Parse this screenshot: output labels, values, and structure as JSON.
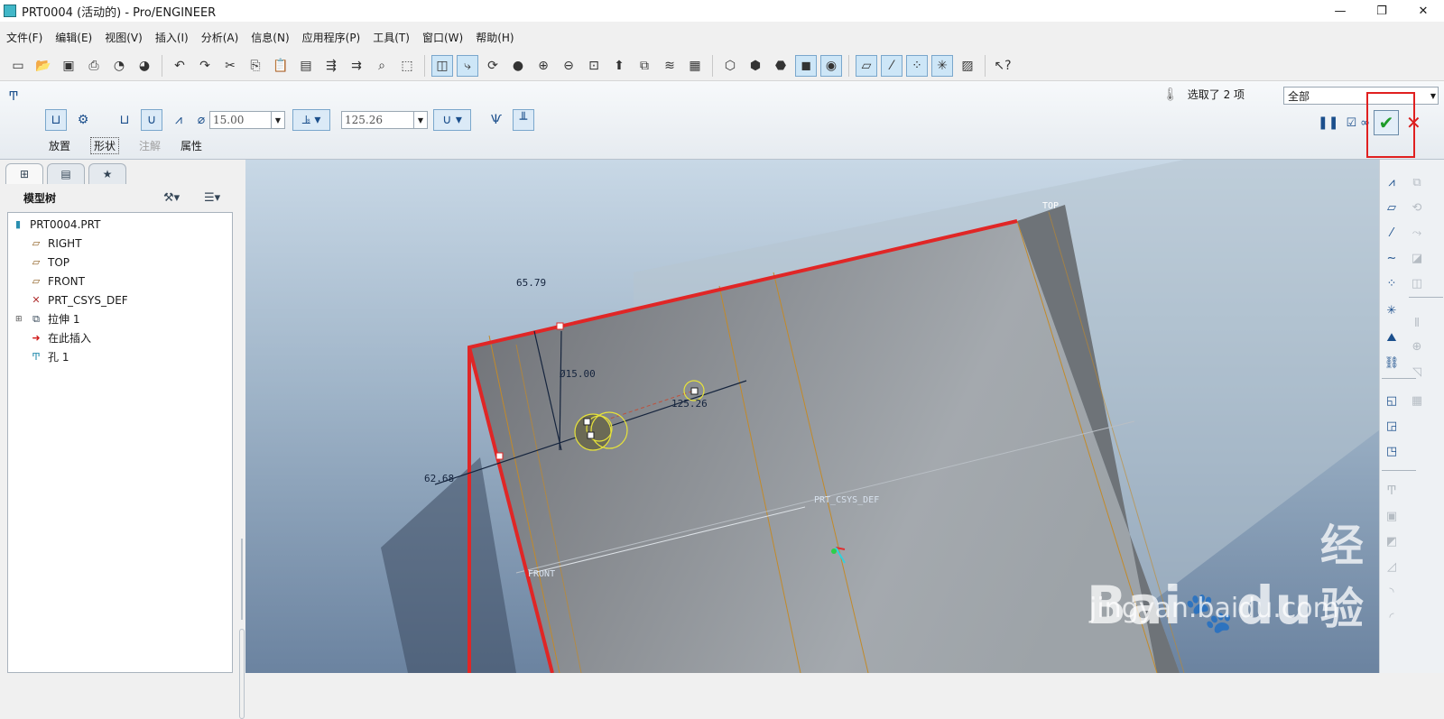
{
  "window": {
    "title": "PRT0004 (活动的) - Pro/ENGINEER",
    "controls": [
      "—",
      "❐",
      "✕"
    ]
  },
  "menu": [
    "文件(F)",
    "编辑(E)",
    "视图(V)",
    "插入(I)",
    "分析(A)",
    "信息(N)",
    "应用程序(P)",
    "工具(T)",
    "窗口(W)",
    "帮助(H)"
  ],
  "dashboard": {
    "diameter_value": "15.00",
    "depth_value": "125.26",
    "tabs": {
      "placement": "放置",
      "shape": "形状",
      "note": "注解",
      "properties": "属性"
    },
    "selection_info": "选取了 2 项",
    "filter_value": "全部"
  },
  "model_tree": {
    "header": "模型树",
    "items": [
      {
        "label": "PRT0004.PRT",
        "icon": "part-icon"
      },
      {
        "label": "RIGHT",
        "icon": "datum-plane-icon"
      },
      {
        "label": "TOP",
        "icon": "datum-plane-icon"
      },
      {
        "label": "FRONT",
        "icon": "datum-plane-icon"
      },
      {
        "label": "PRT_CSYS_DEF",
        "icon": "csys-icon"
      },
      {
        "label": "拉伸 1",
        "icon": "extrude-icon"
      },
      {
        "label": "在此插入",
        "icon": "insert-here-arrow-icon"
      },
      {
        "label": "孔 1",
        "icon": "hole-icon"
      }
    ]
  },
  "viewport": {
    "dim_top": "65.79",
    "dim_diameter": "Ø15.00",
    "dim_depth": "125.26",
    "dim_left": "62.68",
    "label_top": "TOP",
    "label_csys": "PRT_CSYS_DEF",
    "label_front": "FRONT",
    "edge_highlight_color": "#e02626"
  },
  "watermark": {
    "brand_left": "Bai",
    "brand_mid": "du",
    "brand_cn": "经验",
    "url": "jingyan.baidu.com"
  }
}
